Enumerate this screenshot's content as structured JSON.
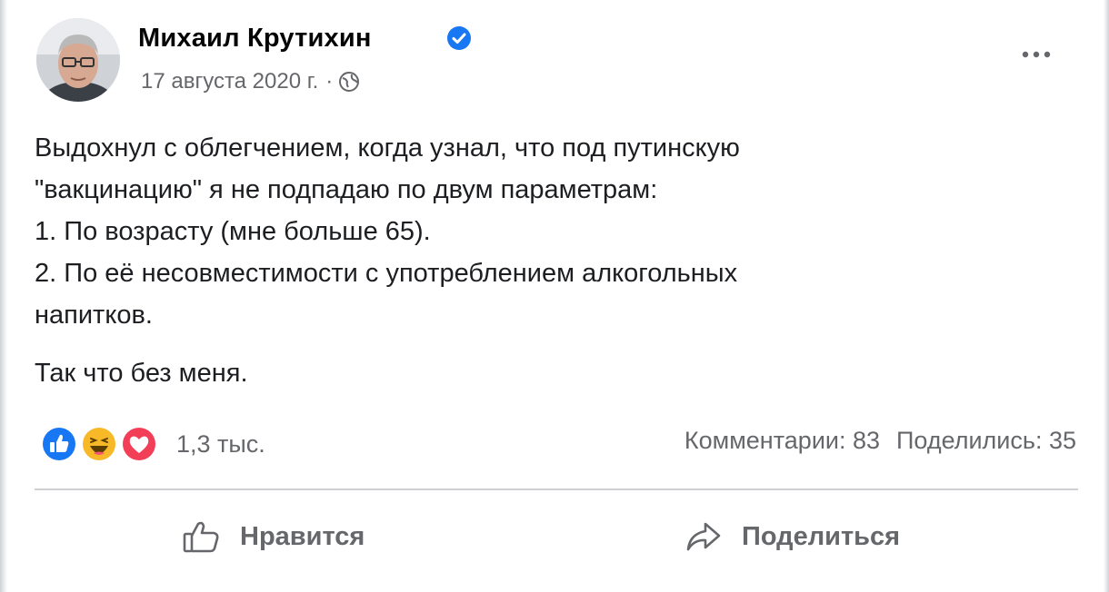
{
  "post": {
    "author": "Михаил Крутихин",
    "date": "17 августа 2020 г.",
    "separator": "·",
    "text_lines": [
      "Выдохнул с облегчением, когда узнал, что под путинскую",
      "\"вакцинацию\" я не подпадаю по двум параметрам:",
      "1. По возрасту (мне больше 65).",
      "2. По её несовместимости с употреблением алкогольных",
      "напитков."
    ],
    "closing_line": "Так что без меня."
  },
  "reactions": {
    "icons": [
      "like-reaction-icon",
      "haha-reaction-icon",
      "love-reaction-icon"
    ],
    "count": "1,3 тыс."
  },
  "stats": {
    "comments": "Комментарии: 83",
    "shares": "Поделились: 35"
  },
  "actions": {
    "like_label": "Нравится",
    "share_label": "Поделиться"
  },
  "colors": {
    "text": "#1c1e21",
    "secondary": "#65676b",
    "verified": "#1877f2",
    "like": "#1877f2",
    "haha": "#f7b928",
    "love": "#f33e58",
    "divider": "#ced0d4"
  }
}
